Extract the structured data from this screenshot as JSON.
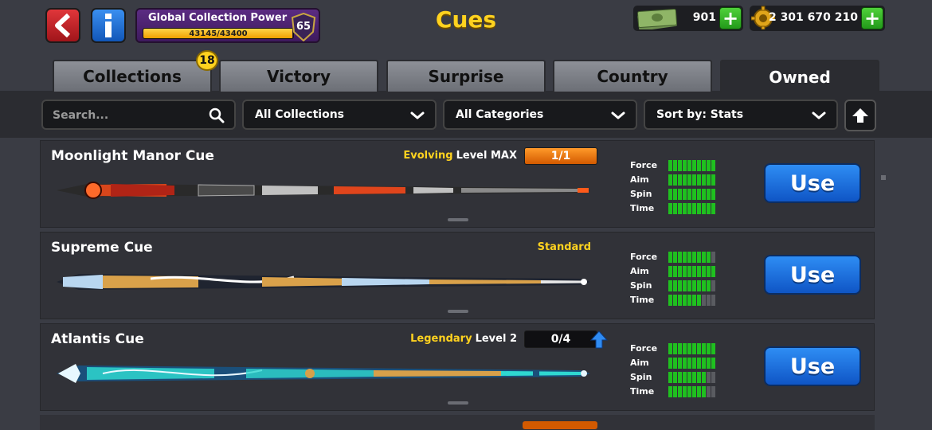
{
  "header": {
    "back_icon": "chevron-left-icon",
    "info_icon": "info-icon",
    "title": "Cues",
    "global_power": {
      "label": "Global Collection Power",
      "progress_text": "43145/43400",
      "progress_fraction": 0.994,
      "level": "65"
    },
    "cash": {
      "value": "901",
      "icon": "cash-icon",
      "plus": "+"
    },
    "coins": {
      "value": "2 301 670 210",
      "icon": "coin-icon",
      "plus": "+"
    }
  },
  "tabs": [
    {
      "label": "Collections",
      "badge": "18",
      "active": false
    },
    {
      "label": "Victory",
      "active": false
    },
    {
      "label": "Surprise",
      "active": false
    },
    {
      "label": "Country",
      "active": false
    },
    {
      "label": "Owned",
      "active": true
    }
  ],
  "filters": {
    "search_placeholder": "Search...",
    "collection": "All Collections",
    "category": "All Categories",
    "sort": "Sort by: Stats"
  },
  "stat_labels": [
    "Force",
    "Aim",
    "Spin",
    "Time"
  ],
  "cues": [
    {
      "name": "Moonlight Manor Cue",
      "rarity": "Evolving",
      "level": "Level MAX",
      "progress": "1/1",
      "progress_style": "orange",
      "stats": [
        10,
        10,
        10,
        10
      ],
      "use_label": "Use",
      "colors": [
        "#e0451c",
        "#a81d10",
        "#2a2a2a",
        "#c0c0c0"
      ]
    },
    {
      "name": "Supreme Cue",
      "rarity": "Standard",
      "level": "",
      "progress": "",
      "progress_style": "none",
      "stats": [
        9,
        10,
        9,
        7
      ],
      "use_label": "Use",
      "colors": [
        "#d9a14a",
        "#1f2430",
        "#b8d6f0",
        "#ffffff"
      ]
    },
    {
      "name": "Atlantis Cue",
      "rarity": "Legendary",
      "level": "Level 2",
      "progress": "0/4",
      "progress_style": "dark",
      "stats": [
        10,
        10,
        8,
        8
      ],
      "use_label": "Use",
      "colors": [
        "#2fd7d0",
        "#1a4f7a",
        "#d6a04a",
        "#e8f8ff"
      ]
    }
  ]
}
